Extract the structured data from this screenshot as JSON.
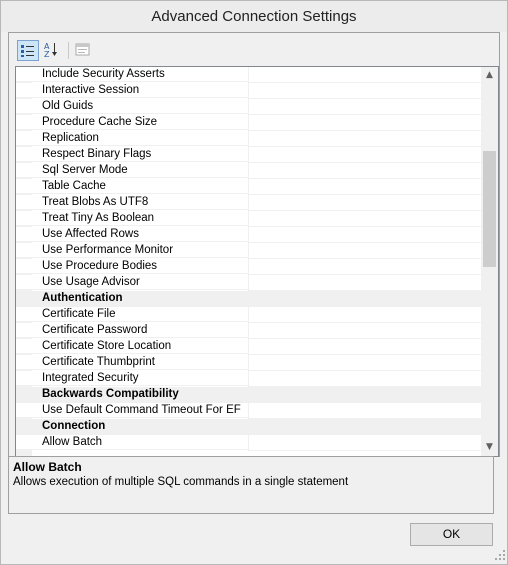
{
  "window": {
    "title": "Advanced Connection Settings"
  },
  "toolbar": {
    "categorized_icon": "categorized-icon",
    "alphabetical_icon": "alphabetical-icon",
    "property_pages_icon": "property-pages-icon"
  },
  "grid": {
    "rows": [
      {
        "type": "prop",
        "label": "Include Security Asserts"
      },
      {
        "type": "prop",
        "label": "Interactive Session"
      },
      {
        "type": "prop",
        "label": "Old Guids"
      },
      {
        "type": "prop",
        "label": "Procedure Cache Size"
      },
      {
        "type": "prop",
        "label": "Replication"
      },
      {
        "type": "prop",
        "label": "Respect Binary Flags"
      },
      {
        "type": "prop",
        "label": "Sql Server Mode"
      },
      {
        "type": "prop",
        "label": "Table Cache"
      },
      {
        "type": "prop",
        "label": "Treat Blobs As UTF8"
      },
      {
        "type": "prop",
        "label": "Treat Tiny As Boolean"
      },
      {
        "type": "prop",
        "label": "Use Affected Rows"
      },
      {
        "type": "prop",
        "label": "Use Performance Monitor"
      },
      {
        "type": "prop",
        "label": "Use Procedure Bodies"
      },
      {
        "type": "prop",
        "label": "Use Usage Advisor"
      },
      {
        "type": "cat",
        "label": "Authentication"
      },
      {
        "type": "prop",
        "label": "Certificate File"
      },
      {
        "type": "prop",
        "label": "Certificate Password"
      },
      {
        "type": "prop",
        "label": "Certificate Store Location"
      },
      {
        "type": "prop",
        "label": "Certificate Thumbprint"
      },
      {
        "type": "prop",
        "label": "Integrated Security"
      },
      {
        "type": "cat",
        "label": "Backwards Compatibility"
      },
      {
        "type": "prop",
        "label": "Use Default Command Timeout For EF"
      },
      {
        "type": "cat",
        "label": "Connection"
      },
      {
        "type": "prop",
        "label": "Allow Batch"
      }
    ],
    "scroll_position": 0.55
  },
  "help": {
    "title": "Allow Batch",
    "description": "Allows execution of multiple SQL commands in a single statement"
  },
  "buttons": {
    "ok": "OK"
  }
}
